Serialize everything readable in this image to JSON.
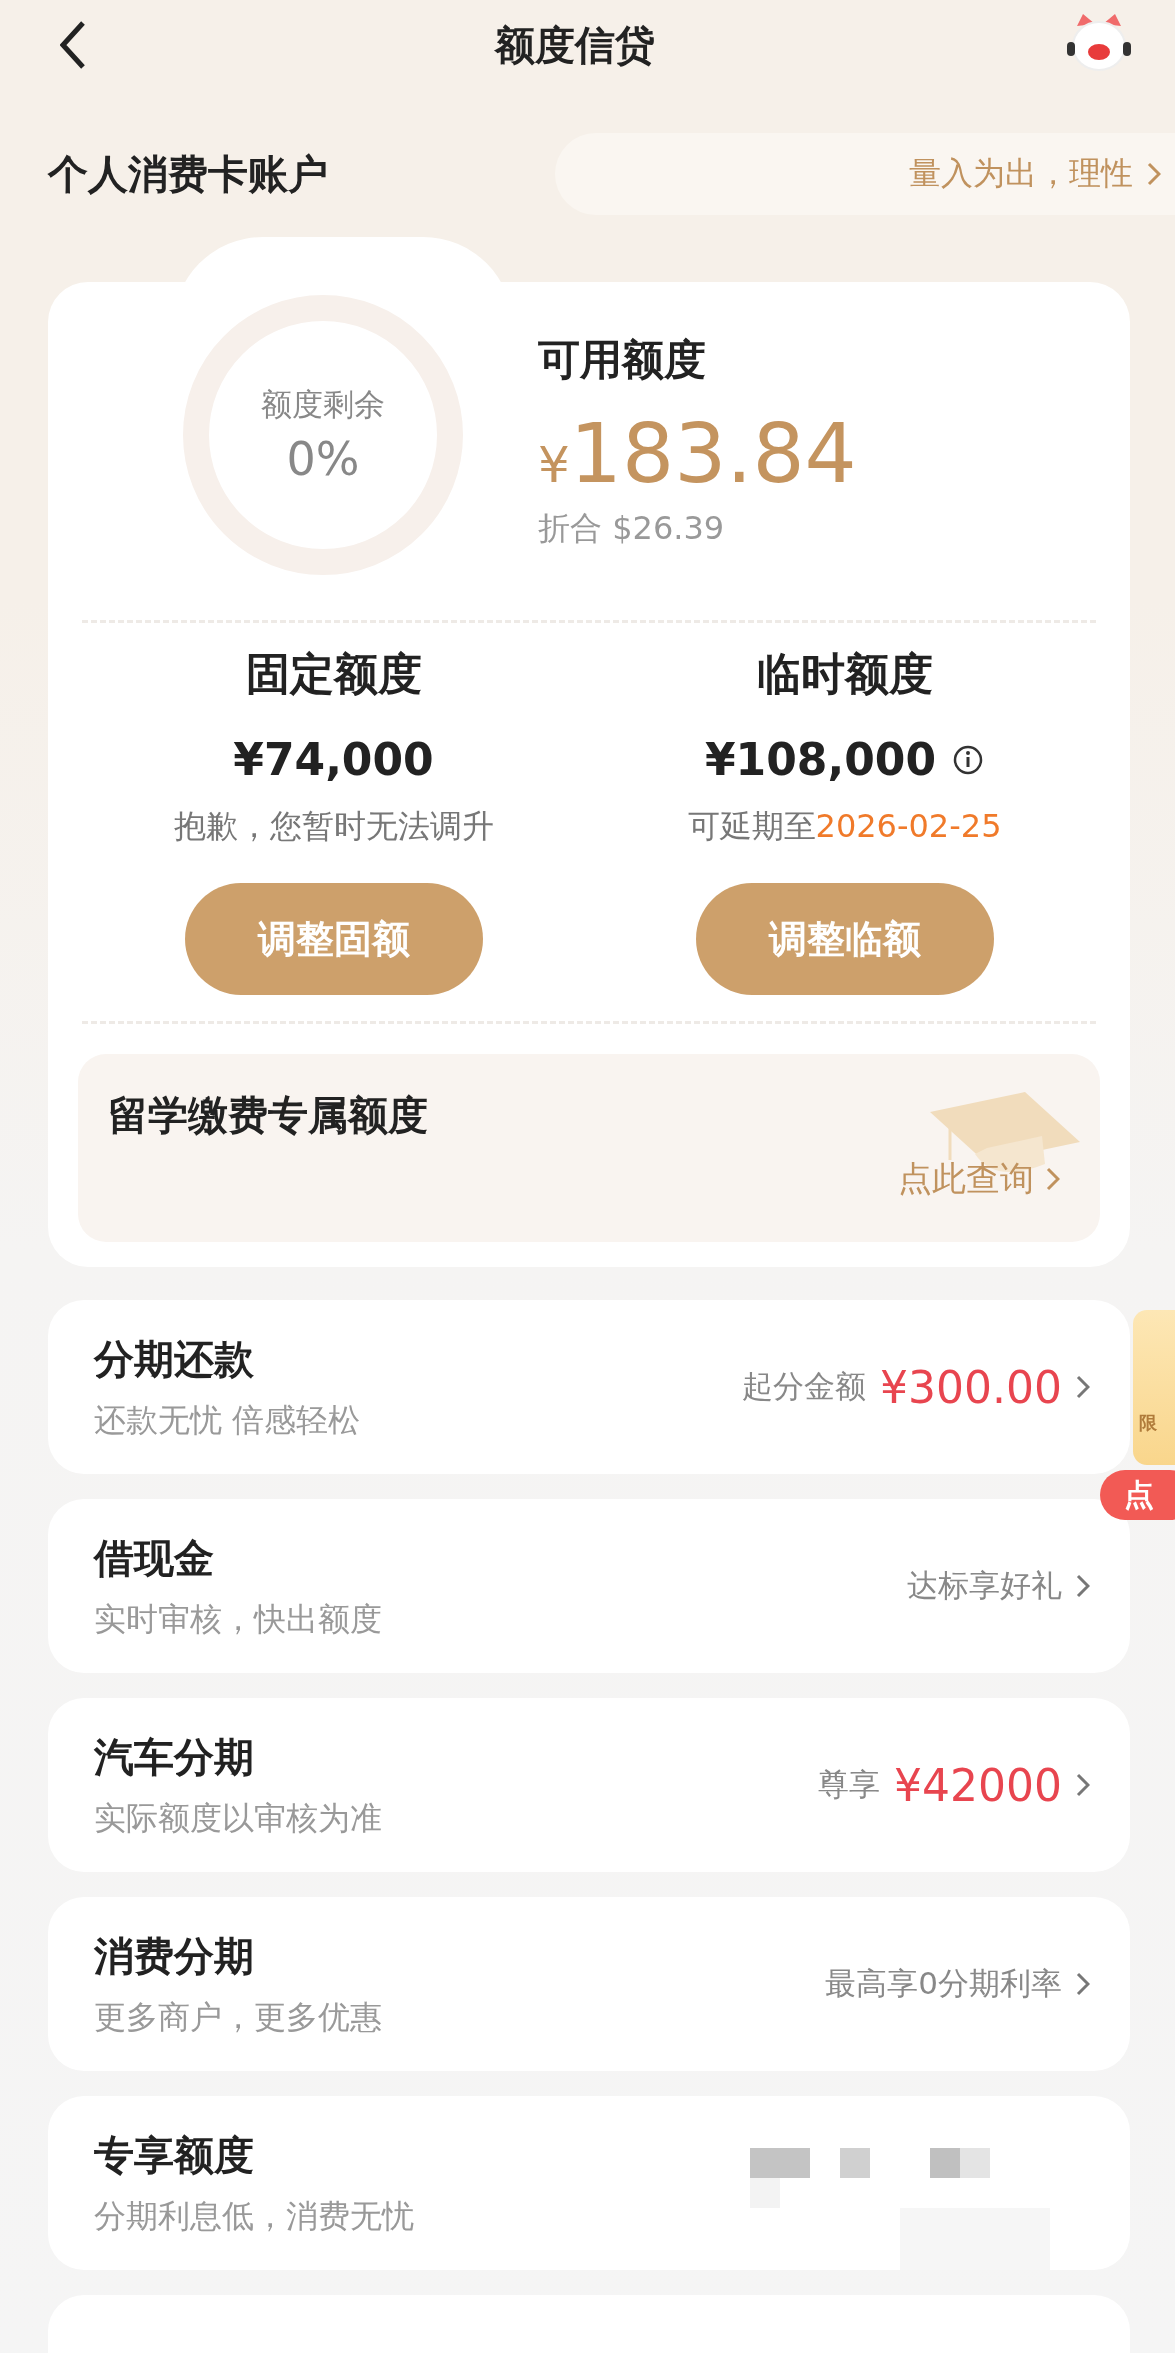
{
  "header": {
    "title": "额度信贷"
  },
  "account": {
    "title": "个人消费卡账户",
    "tip": "量入为出，理性"
  },
  "summary": {
    "ring_label": "额度剩余",
    "ring_value": "0%",
    "available_label": "可用额度",
    "currency": "¥",
    "amount": "183.84",
    "converted_label": "折合",
    "converted": "$26.39"
  },
  "limits": [
    {
      "title": "固定额度",
      "amount": "¥74,000",
      "info": false,
      "note": "抱歉，您暂时无法调升",
      "button": "调整固额"
    },
    {
      "title": "临时额度",
      "amount": "¥108,000",
      "info": true,
      "note": "可延期至",
      "date": "2026-02-25",
      "button": "调整临额"
    }
  ],
  "study": {
    "title": "留学缴费专属额度",
    "link": "点此查询"
  },
  "services": [
    {
      "title": "分期还款",
      "subtitle": "还款无忧 倍感轻松",
      "note": "起分金额",
      "amount": "¥300.00",
      "redacted": false
    },
    {
      "title": "借现金",
      "subtitle": "实时审核，快出额度",
      "note": "达标享好礼",
      "redacted": false
    },
    {
      "title": "汽车分期",
      "subtitle": "实际额度以审核为准",
      "note": "尊享",
      "amount": "¥42000",
      "redacted": false
    },
    {
      "title": "消费分期",
      "subtitle": "更多商户，更多优惠",
      "note": "最高享0分期利率",
      "redacted": false
    },
    {
      "title": "专享额度",
      "subtitle": "分期利息低，消费无忧",
      "redacted": true
    }
  ],
  "promo": {
    "label": "限",
    "button": "点"
  }
}
